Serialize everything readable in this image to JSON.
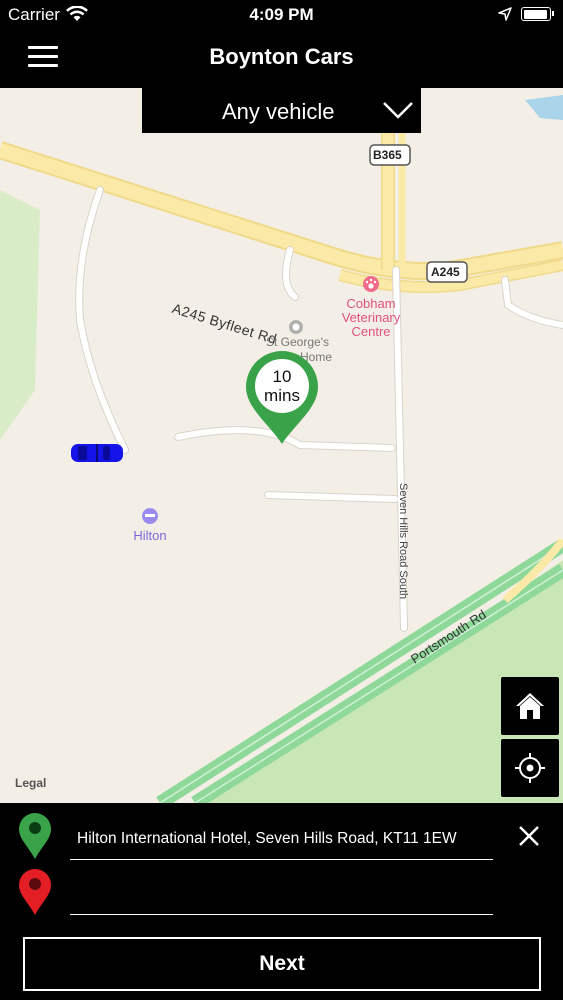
{
  "status_bar": {
    "carrier": "Carrier",
    "time": "4:09 PM"
  },
  "header": {
    "title": "Boynton Cars"
  },
  "vehicle_selector": {
    "selected": "Any vehicle"
  },
  "map": {
    "road_labels": {
      "a245_byfleet": "A245  Byfleet Rd",
      "b365": "B365",
      "a245": "A245",
      "seven_hills": "Seven Hills Road South",
      "portsmouth": "Portsmouth Rd"
    },
    "poi": {
      "vet_line1": "Cobham",
      "vet_line2": "Veterinary",
      "vet_line3": "Centre",
      "stgeorges_line1": "St George's",
      "stgeorges_line2": "Home",
      "hilton": "Hilton"
    },
    "pickup_eta_line1": "10",
    "pickup_eta_line2": "mins",
    "legal": "Legal"
  },
  "booking": {
    "pickup_address": "Hilton International Hotel, Seven Hills Road, KT11 1EW",
    "dropoff_address": "",
    "next_label": "Next"
  },
  "colors": {
    "pickup_pin": "#3aa34a",
    "dropoff_pin": "#e31e24",
    "car": "#1414e8",
    "map_background": "#f4efe6",
    "road_yellow": "#fbe9a7",
    "park_green": "#c9e7b6",
    "brand_bar": "#000000"
  },
  "icons": [
    "wifi-icon",
    "location-arrow-icon",
    "battery-icon",
    "hamburger-menu-icon",
    "chevron-down-icon",
    "home-icon",
    "crosshair-locate-icon",
    "pickup-pin-icon",
    "dropoff-pin-icon",
    "close-icon",
    "car-icon"
  ]
}
